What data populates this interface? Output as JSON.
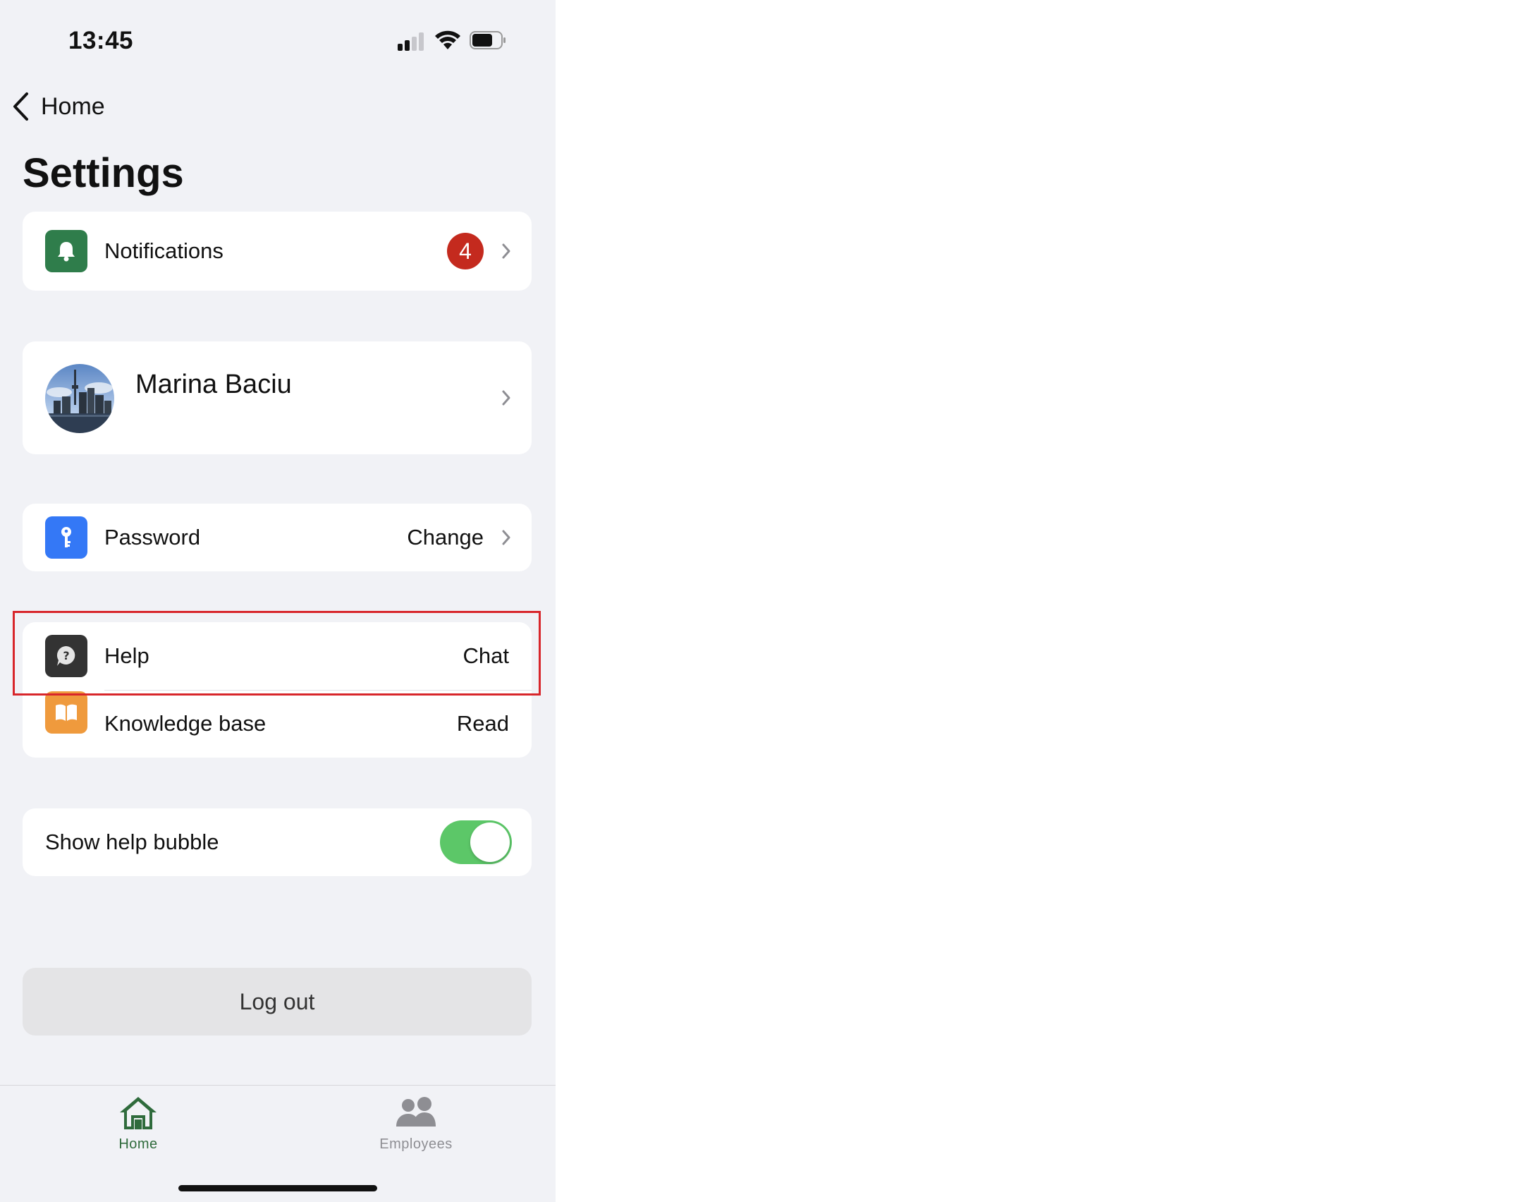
{
  "status_bar": {
    "time": "13:45"
  },
  "nav": {
    "back_label": "Home"
  },
  "page": {
    "title": "Settings"
  },
  "notifications": {
    "label": "Notifications",
    "badge_count": "4",
    "icon": "bell-icon",
    "icon_color": "#2f7d4b"
  },
  "profile": {
    "name": "Marina Baciu"
  },
  "password": {
    "label": "Password",
    "value": "Change",
    "icon": "key-icon",
    "icon_color": "#3478f6"
  },
  "help": {
    "label": "Help",
    "value": "Chat",
    "icon": "question-bubble-icon",
    "icon_color": "#333333"
  },
  "knowledge_base": {
    "label": "Knowledge base",
    "value": "Read",
    "icon": "book-icon",
    "icon_color": "#ef9a3d"
  },
  "help_bubble": {
    "label": "Show help bubble",
    "enabled": true,
    "toggle_color": "#5cc768"
  },
  "logout": {
    "label": "Log out"
  },
  "tabbar": {
    "home_label": "Home",
    "employees_label": "Employees",
    "active_color": "#2f6b3c",
    "inactive_color": "#8e8e93"
  },
  "highlight_color": "#d8262b"
}
